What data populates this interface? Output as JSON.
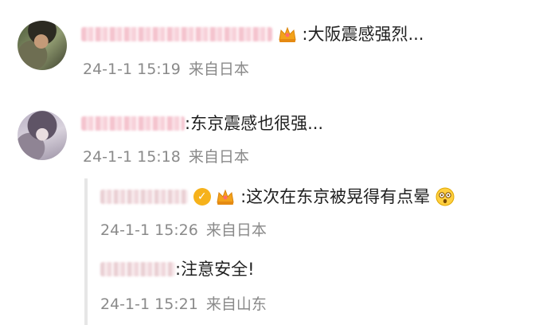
{
  "comments": [
    {
      "text": ":大阪震感强烈...",
      "time": "24-1-1 15:19",
      "location": "来自日本",
      "badge_icon": "crown-icon"
    },
    {
      "text": ":东京震感也很强...",
      "time": "24-1-1 15:18",
      "location": "来自日本"
    }
  ],
  "replies": [
    {
      "text": ":这次在东京被晃得有点晕",
      "time": "24-1-1 15:26",
      "location": "来自日本",
      "badge_icons": [
        "verified-icon",
        "crown-icon"
      ],
      "emoji": "dizzy-face-emoji"
    },
    {
      "text": ":注意安全!",
      "time": "24-1-1 15:21",
      "location": "来自山东"
    }
  ],
  "colors": {
    "meta_text": "#8a8a8a",
    "body_text": "#1f1f1f",
    "reply_border": "#e6e6e6",
    "crown_gold": "#f3a21a"
  }
}
